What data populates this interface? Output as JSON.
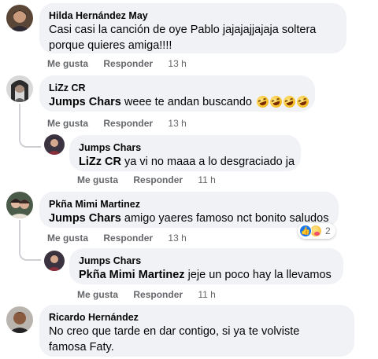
{
  "comments": [
    {
      "author": "Hilda Hernández May",
      "text_line1": "Casi casi la canción de oye Pablo jajajajjajaja soltera",
      "text_line2": "porque quieres amiga!!!!",
      "like": "Me gusta",
      "reply": "Responder",
      "time": "13 h"
    },
    {
      "author": "LiZz CR",
      "mention": "Jumps Chars",
      "text": "weee te andan buscando",
      "emoji_count": 4,
      "like": "Me gusta",
      "reply": "Responder",
      "time": "13 h"
    },
    {
      "author": "Jumps Chars",
      "mention": "LiZz CR",
      "text": "ya vi no maaa a lo desgraciado ja",
      "like": "Me gusta",
      "reply": "Responder",
      "time": "11 h"
    },
    {
      "author": "Pkña Mimi Martinez",
      "mention": "Jumps Chars",
      "text": "amigo yaeres famoso nct bonito saludos",
      "like": "Me gusta",
      "reply": "Responder",
      "time": "13 h",
      "reactions_count": "2"
    },
    {
      "author": "Jumps Chars",
      "mention": "Pkña Mimi Martinez",
      "text": "jeje un poco hay la llevamos",
      "like": "Me gusta",
      "reply": "Responder",
      "time": "11 h"
    },
    {
      "author": "Ricardo Hernández",
      "text_line1": "No creo que tarde en dar contigo, si ya te volviste",
      "text_line2": "famosa Faty."
    }
  ],
  "colors": {
    "bubble": "#f0f2f5",
    "secondary_text": "#65676b",
    "like_blue": "#1877f2"
  }
}
